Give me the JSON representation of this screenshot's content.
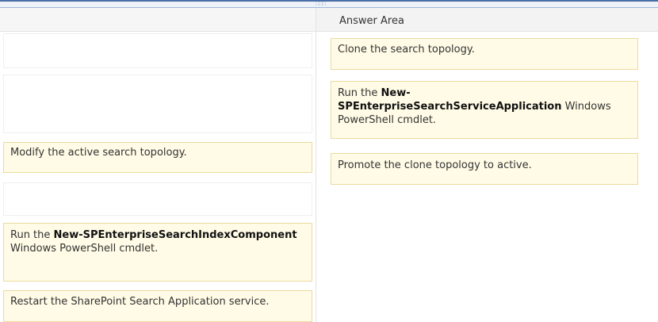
{
  "answer_area": {
    "title": "Answer Area"
  },
  "left_items": [
    {
      "text": "Modify the active search topology."
    },
    {
      "prefix": "Run the ",
      "bold": "New-SPEnterpriseSearchIndexComponent",
      "suffix": " Windows PowerShell cmdlet."
    },
    {
      "text": "Restart the SharePoint Search Application service."
    }
  ],
  "answer_items": [
    {
      "text": "Clone the search topology."
    },
    {
      "prefix": "Run the ",
      "bold": "New-SPEnterpriseSearchServiceApplication",
      "suffix": " Windows PowerShell cmdlet."
    },
    {
      "text": "Promote the clone topology to active."
    }
  ]
}
